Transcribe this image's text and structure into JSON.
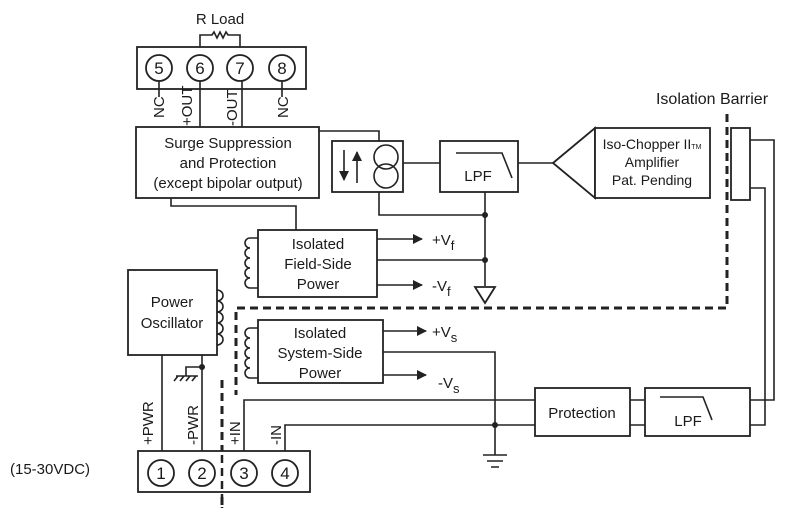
{
  "r_load": "R Load",
  "top_terminals": [
    "5",
    "6",
    "7",
    "8"
  ],
  "top_labels": [
    "NC",
    "+OUT",
    "-OUT",
    "NC"
  ],
  "surge": [
    "Surge Suppression",
    "and Protection",
    "(except bipolar output)"
  ],
  "lpf_top": "LPF",
  "amplifier": [
    "Iso-Chopper II",
    "TM",
    "Amplifier",
    "Pat. Pending"
  ],
  "isolation_barrier": "Isolation Barrier",
  "field_power": [
    "Isolated",
    "Field-Side",
    "Power"
  ],
  "vf_plus": {
    "main": "+V",
    "sub": "f"
  },
  "vf_minus": {
    "main": "-V",
    "sub": "f"
  },
  "oscillator": [
    "Power",
    "Oscillator"
  ],
  "system_power": [
    "Isolated",
    "System-Side",
    "Power"
  ],
  "vs_plus": {
    "main": "+V",
    "sub": "s"
  },
  "vs_minus": {
    "main": "-V",
    "sub": "s"
  },
  "bottom_labels": [
    "+PWR",
    "-PWR",
    "+IN",
    "-IN"
  ],
  "bottom_terminals": [
    "1",
    "2",
    "3",
    "4"
  ],
  "supply": "(15-30VDC)",
  "protection": "Protection",
  "lpf_bottom": "LPF"
}
